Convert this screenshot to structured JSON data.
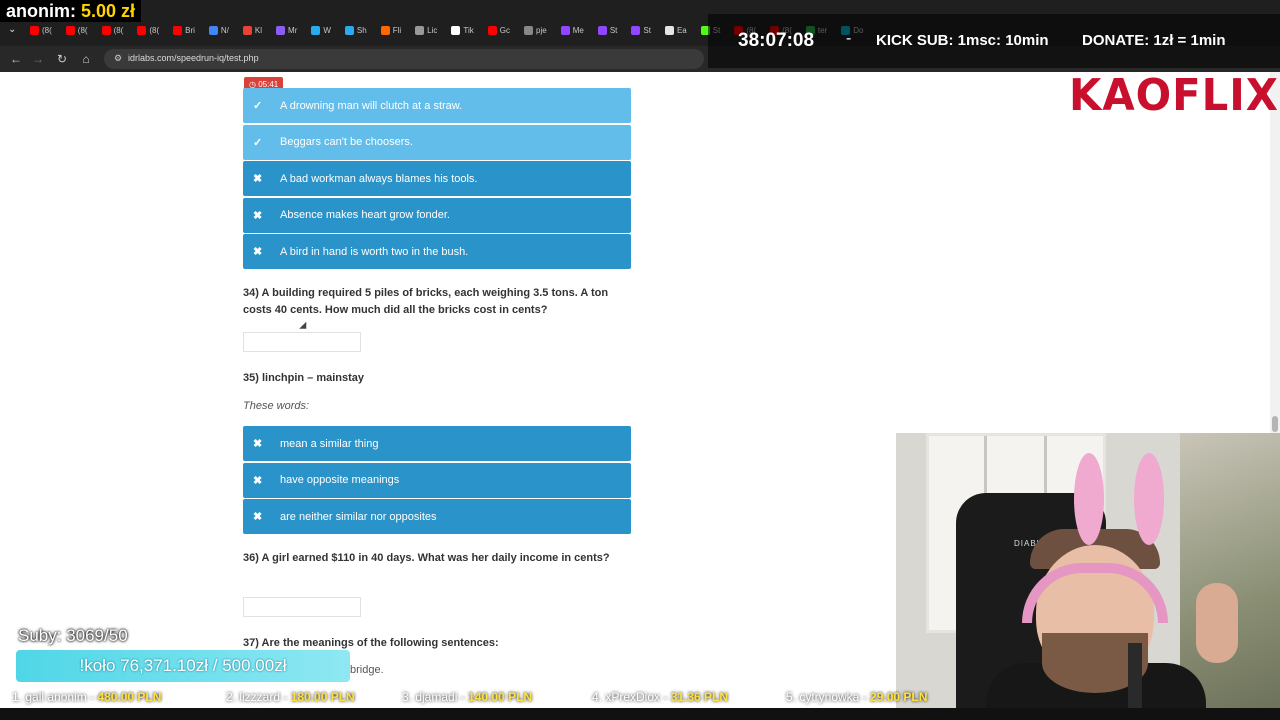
{
  "overlay": {
    "anon_name": "anonim:",
    "anon_amount": "5.00 zł",
    "stream_time": "38:07:08",
    "dash": "-",
    "kick_sub": "KICK SUB: 1msc: 10min",
    "donate": "DONATE: 1zł = 1min",
    "brand": "KAOFLIX",
    "subs": "Suby: 3069/50",
    "wheel": "!koło 76,371.10zł / 500.00zł",
    "ticker": [
      {
        "name": "1. gall anonim -",
        "amount": "480.00 PLN"
      },
      {
        "name": "2. lizzzard -",
        "amount": "180.00 PLN"
      },
      {
        "name": "3. djamadi -",
        "amount": "140.00 PLN"
      },
      {
        "name": "4. xPrexDiox -",
        "amount": "31.36 PLN"
      },
      {
        "name": "5. cytrynowka -",
        "amount": "29.00 PLN"
      }
    ]
  },
  "browser": {
    "url": "idrlabs.com/speedrun-iq/test.php",
    "tabs": [
      "(8(",
      "(8(",
      "(8(",
      "(8(",
      "Bri",
      "N/",
      "Kl",
      "Mr",
      "W",
      "Sh",
      "Fli",
      "Lic",
      "Tik",
      "Gc",
      "pje",
      "Me",
      "St",
      "St",
      "Ea",
      "St",
      "(8(",
      "(8(",
      "ter",
      "Do"
    ]
  },
  "quiz": {
    "timer": "05:41",
    "options_q33": [
      {
        "label": "A drowning man will clutch at a straw.",
        "selected": true
      },
      {
        "label": "Beggars can't be choosers.",
        "selected": true
      },
      {
        "label": "A bad workman always blames his tools.",
        "selected": false
      },
      {
        "label": "Absence makes heart grow fonder.",
        "selected": false
      },
      {
        "label": "A bird in hand is worth two in the bush.",
        "selected": false
      }
    ],
    "q34": "34) A building required 5 piles of bricks, each weighing 3.5 tons. A ton costs 40 cents. How much did all the bricks cost in cents?",
    "q35": "35) linchpin – mainstay",
    "q35_hint": "These words:",
    "options_q35": [
      {
        "label": "mean a similar thing",
        "selected": false
      },
      {
        "label": "have opposite meanings",
        "selected": false
      },
      {
        "label": "are neither similar nor opposites",
        "selected": false
      }
    ],
    "q36": "36) A girl earned $110 in 40 days. What was her daily income in cents?",
    "q37": "37) Are the meanings of the following sentences:",
    "q37_partial": "bridge."
  },
  "webcam": {
    "chair_brand": "DIABLO"
  }
}
